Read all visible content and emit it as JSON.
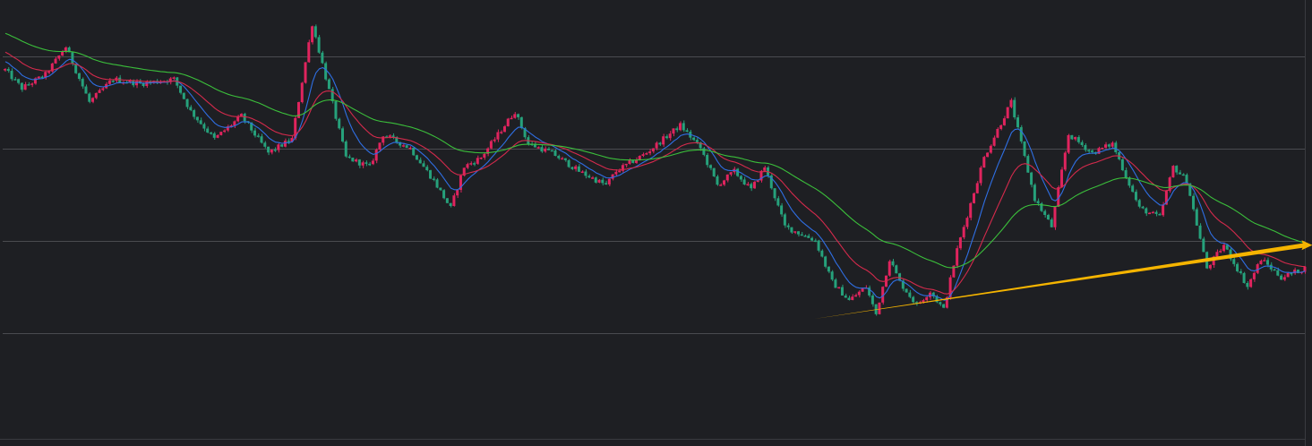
{
  "theme": {
    "background": "#1e1f23",
    "grid": "#4a4b50",
    "border": "#3a3b40",
    "up": "#e0245e",
    "down": "#26a17b",
    "ma_fast": "#2f6fe4",
    "ma_mid": "#d42a4c",
    "ma_slow": "#3bbf3b",
    "trendline": "#f5b400"
  },
  "chart_data": {
    "type": "candlestick",
    "title": "",
    "xlabel": "",
    "ylabel": "",
    "ylim": [
      0,
      100
    ],
    "grid": true,
    "grid_y": [
      83,
      63,
      43,
      23
    ],
    "segments": [
      [
        0,
        80
      ],
      [
        5,
        76
      ],
      [
        12,
        79
      ],
      [
        18,
        85
      ],
      [
        25,
        73
      ],
      [
        32,
        78
      ],
      [
        40,
        77
      ],
      [
        50,
        78
      ],
      [
        55,
        71
      ],
      [
        62,
        65
      ],
      [
        70,
        70
      ],
      [
        78,
        62
      ],
      [
        85,
        65
      ],
      [
        91,
        90
      ],
      [
        101,
        61
      ],
      [
        108,
        59
      ],
      [
        112,
        66
      ],
      [
        120,
        63
      ],
      [
        127,
        56
      ],
      [
        132,
        50
      ],
      [
        136,
        59
      ],
      [
        141,
        61
      ],
      [
        151,
        71
      ],
      [
        155,
        64
      ],
      [
        162,
        62
      ],
      [
        170,
        58
      ],
      [
        178,
        55
      ],
      [
        181,
        58
      ],
      [
        190,
        62
      ],
      [
        200,
        68
      ],
      [
        206,
        63
      ],
      [
        211,
        55
      ],
      [
        216,
        58
      ],
      [
        221,
        54
      ],
      [
        225,
        59
      ],
      [
        231,
        46
      ],
      [
        240,
        43
      ],
      [
        245,
        34
      ],
      [
        250,
        30
      ],
      [
        255,
        33
      ],
      [
        258,
        27
      ],
      [
        262,
        39
      ],
      [
        265,
        34
      ],
      [
        270,
        29
      ],
      [
        274,
        32
      ],
      [
        278,
        28
      ],
      [
        282,
        41
      ],
      [
        290,
        61
      ],
      [
        298,
        73
      ],
      [
        305,
        52
      ],
      [
        310,
        46
      ],
      [
        315,
        66
      ],
      [
        322,
        62
      ],
      [
        328,
        64
      ],
      [
        336,
        50
      ],
      [
        342,
        48
      ],
      [
        346,
        59
      ],
      [
        350,
        56
      ],
      [
        356,
        37
      ],
      [
        361,
        42
      ],
      [
        368,
        33
      ],
      [
        372,
        39
      ],
      [
        378,
        35
      ],
      [
        385,
        37
      ]
    ],
    "ma_periods": [
      {
        "name": "",
        "period": 9,
        "color_key": "ma_fast"
      },
      {
        "name": "",
        "period": 21,
        "color_key": "ma_mid"
      },
      {
        "name": "",
        "period": 55,
        "color_key": "ma_slow"
      }
    ],
    "annotations": [
      {
        "type": "arrow",
        "from": {
          "x": 240,
          "y": 26
        },
        "to": {
          "x": 385,
          "y": 42
        }
      }
    ]
  }
}
